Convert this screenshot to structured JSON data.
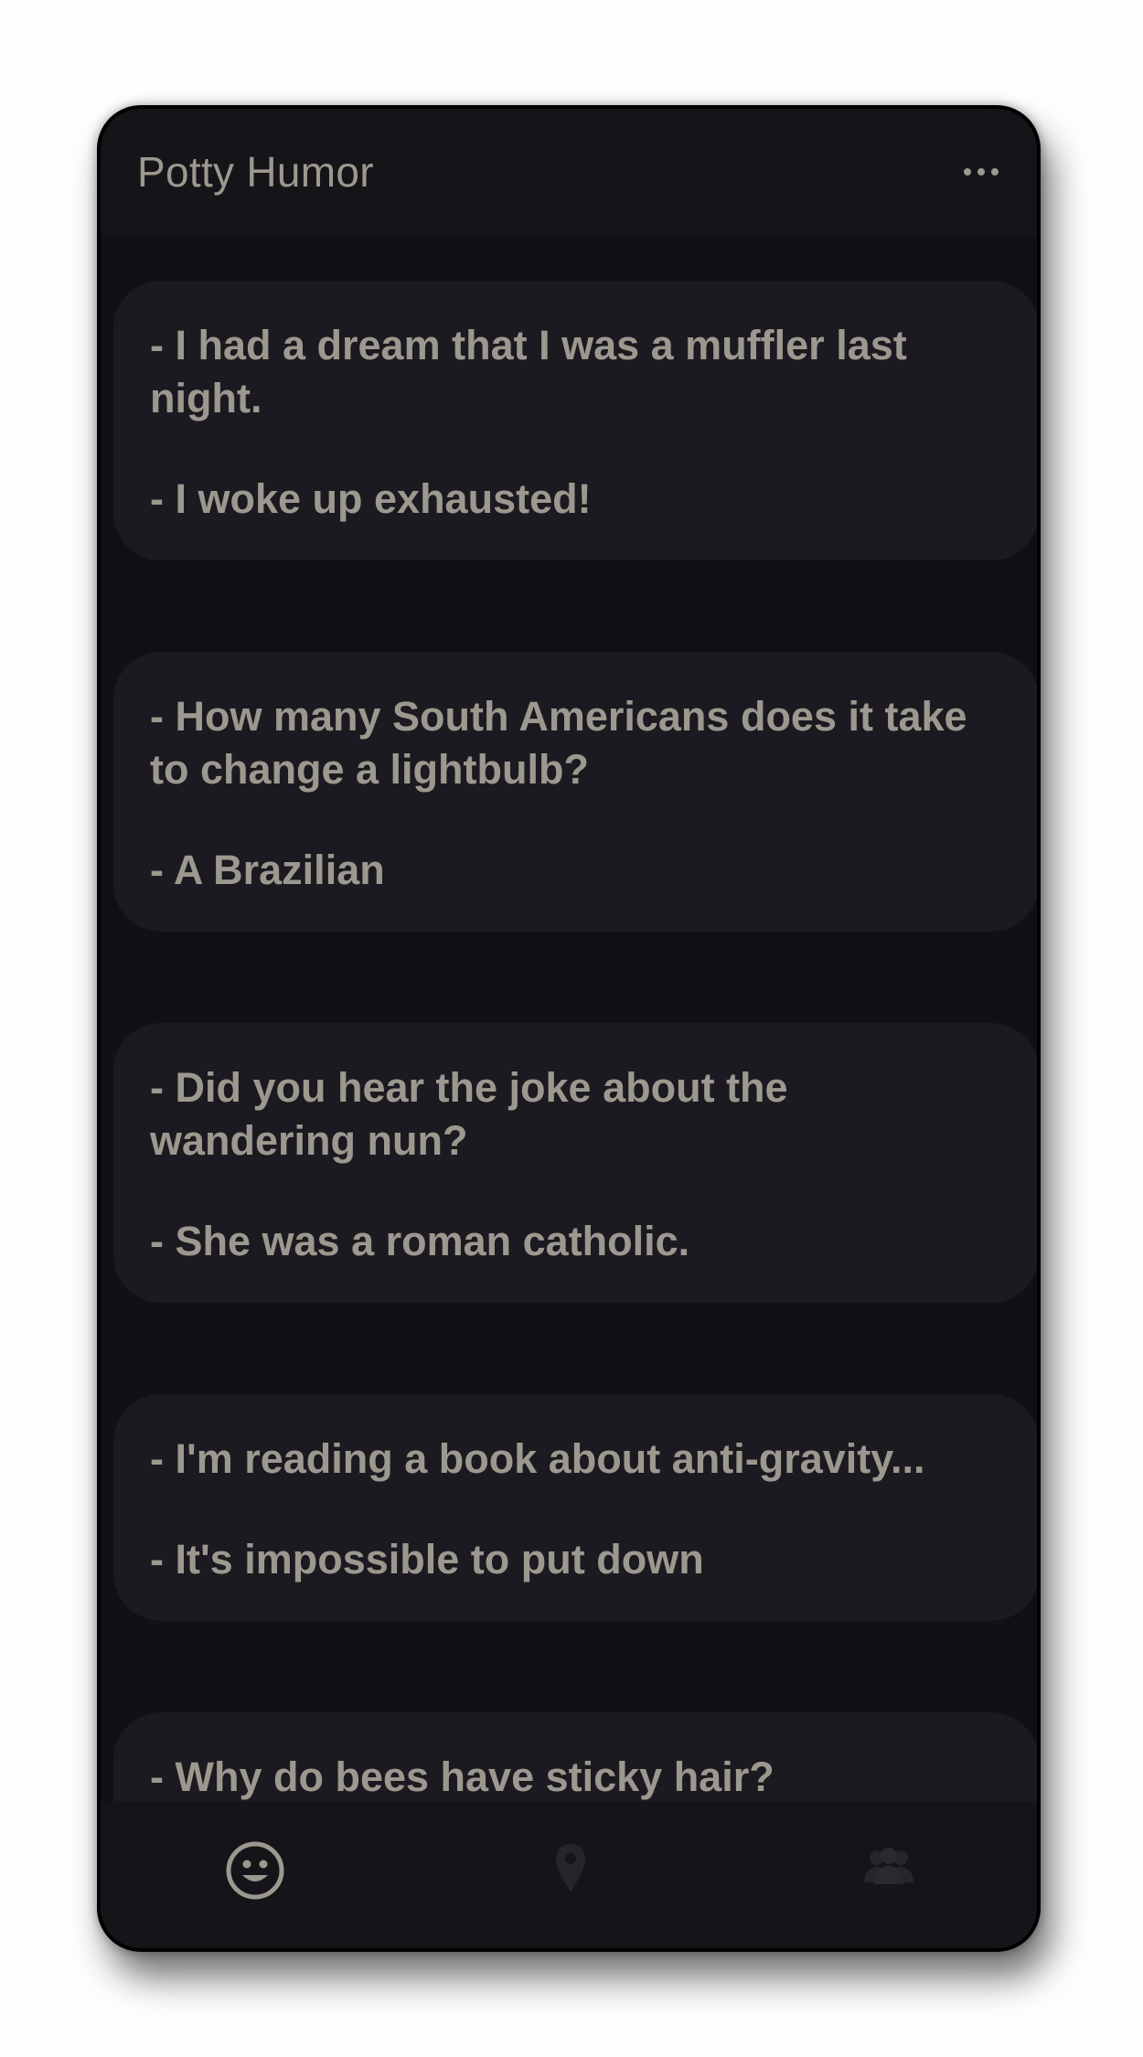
{
  "header": {
    "title": "Potty Humor",
    "menu_icon": "more-horizontal-icon"
  },
  "jokes": [
    {
      "setup": "- I had a dream that I was a muffler last night.",
      "punchline": "- I woke up exhausted!"
    },
    {
      "setup": "- How many South Americans does it take to change a lightbulb?",
      "punchline": "- A Brazilian"
    },
    {
      "setup": "- Did you hear the joke about the wandering nun?",
      "punchline": "- She was a roman catholic."
    },
    {
      "setup": "- I'm reading a book about anti-gravity...",
      "punchline": "- It's impossible to put down"
    },
    {
      "setup": "- Why do bees have sticky hair?",
      "punchline": ""
    }
  ],
  "bottom_nav": {
    "items": [
      {
        "icon": "smiley-icon",
        "active": true
      },
      {
        "icon": "map-pin-icon",
        "active": false
      },
      {
        "icon": "group-icon",
        "active": false
      }
    ]
  },
  "colors": {
    "background": "#111015",
    "card": "#1b1a20",
    "text": "#9d988f",
    "accent": "#7a1420"
  }
}
